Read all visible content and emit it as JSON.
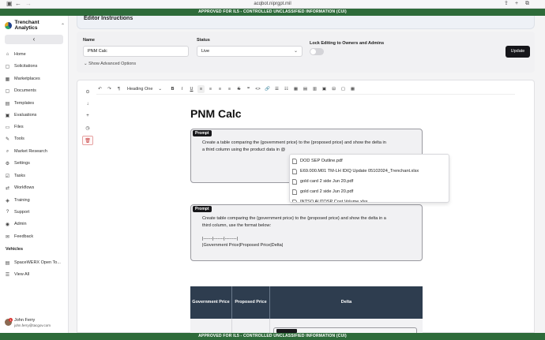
{
  "browser": {
    "url": "acqbot.niprgpt.mil",
    "back_icon": "back-arrow-icon",
    "forward_icon": "forward-arrow-icon"
  },
  "banner": {
    "top": "APPROVED FOR IL5 - CONTROLLED UNCLASSIFIED INFORMATION (CUI)",
    "bottom": "APPROVED FOR IL5 - CONTROLLED UNCLASSIFIED INFORMATION (CUI)",
    "color": "#2e6b3a"
  },
  "sidebar": {
    "org": "Trenchant Analytics",
    "collapse_glyph": "‹",
    "items": [
      {
        "label": "Home",
        "icon": "home-icon"
      },
      {
        "label": "Solicitations",
        "icon": "document-icon"
      },
      {
        "label": "Marketplaces",
        "icon": "grid-icon"
      },
      {
        "label": "Documents",
        "icon": "document-icon"
      },
      {
        "label": "Templates",
        "icon": "template-icon"
      },
      {
        "label": "Evaluations",
        "icon": "clipboard-icon"
      },
      {
        "label": "Files",
        "icon": "folder-icon"
      },
      {
        "label": "Tools",
        "icon": "wrench-icon"
      },
      {
        "label": "Market Research",
        "icon": "search-icon"
      },
      {
        "label": "Settings",
        "icon": "gear-icon"
      },
      {
        "label": "Tasks",
        "icon": "tasks-icon"
      },
      {
        "label": "Workflows",
        "icon": "workflow-icon"
      },
      {
        "label": "Training",
        "icon": "training-icon"
      },
      {
        "label": "Support",
        "icon": "support-icon"
      },
      {
        "label": "Admin",
        "icon": "admin-icon"
      },
      {
        "label": "Feedback",
        "icon": "feedback-icon"
      }
    ],
    "section_vehicles": "Vehicles",
    "vehicles": [
      {
        "label": "SpaceWERX Open To...",
        "icon": "vehicle-icon"
      },
      {
        "label": "View All",
        "icon": "list-icon"
      }
    ],
    "user": {
      "name": "John Ferry",
      "email": "john.ferry@tacgov.com",
      "badge": "1"
    }
  },
  "header": {
    "title": "Editor Instructions"
  },
  "form": {
    "name_label": "Name",
    "name_value": "PNM Calc",
    "status_label": "Status",
    "status_value": "Live",
    "lock_label": "Lock Editing to Owners and Admins",
    "lock_on": false,
    "advanced": "Show Advanced Options",
    "update": "Update"
  },
  "toolbar": {
    "undo": "↶",
    "redo": "↷",
    "heading": "Heading One",
    "bold": "B",
    "italic": "I",
    "underline": "U",
    "strike": "S"
  },
  "document": {
    "title": "PNM Calc",
    "prompt_badge": "Prompt",
    "prompt1": "Create a table comparing the {government price} to the {proposed price} and show the delta in\na third column using the product data in @",
    "prompt2": "Create table comparing the {government price} to the {proposed price} and show the delta in a\nthird column, use the format below:\n\n|------|-------|--------|\n|Government Price|Proposed Price|Delta|",
    "mention_options": [
      "DOD SEP Outline.pdf",
      "E69.000.M01 TM-LH IDIQ Update 05102024_Trenchant.xlsx",
      "gold card 2 side Jun 20.pdf",
      "gold card 2 side Jun 20.pdf",
      "INTSO AUTOSP Cost Volume.xlsx"
    ],
    "table_headers": [
      "Government Price",
      "Proposed Price",
      "Delta"
    ]
  }
}
